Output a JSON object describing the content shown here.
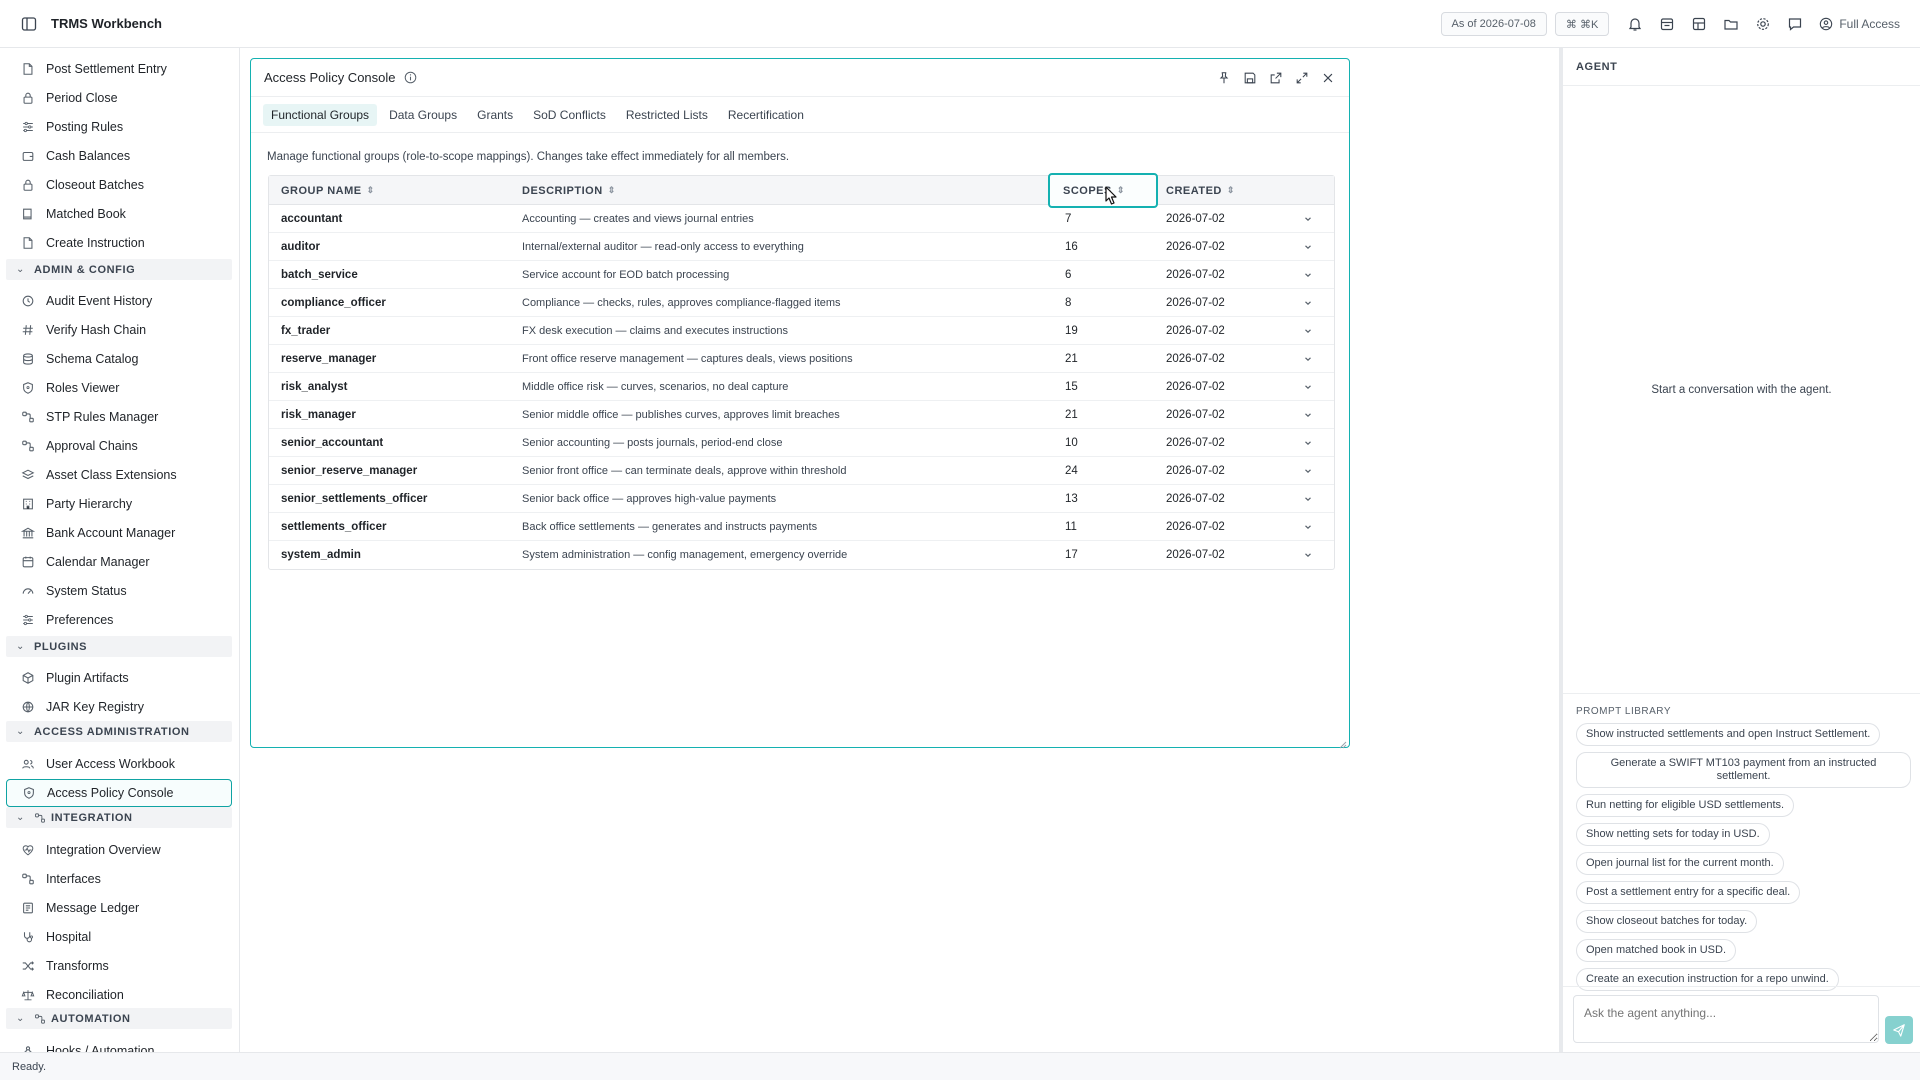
{
  "app": {
    "title": "TRMS Workbench"
  },
  "topbar": {
    "as_of": "As of 2026-07-08",
    "shortcut": "⌘ ⌘K",
    "access": "Full Access",
    "icons": [
      "bell-icon",
      "calendar-icon",
      "layout-icon",
      "folder-icon",
      "gear-icon",
      "chat-icon"
    ]
  },
  "sidebar": {
    "items_top": [
      {
        "label": "Post Settlement Entry",
        "icon": "doc-edit-icon"
      },
      {
        "label": "Period Close",
        "icon": "lock-icon"
      },
      {
        "label": "Posting Rules",
        "icon": "sliders-icon"
      },
      {
        "label": "Cash Balances",
        "icon": "wallet-icon"
      },
      {
        "label": "Closeout Batches",
        "icon": "lock-icon"
      },
      {
        "label": "Matched Book",
        "icon": "book-icon"
      },
      {
        "label": "Create Instruction",
        "icon": "doc-edit-icon"
      }
    ],
    "section_admin": "ADMIN & CONFIG",
    "items_admin": [
      {
        "label": "Audit Event History",
        "icon": "history-icon"
      },
      {
        "label": "Verify Hash Chain",
        "icon": "hash-icon"
      },
      {
        "label": "Schema Catalog",
        "icon": "database-icon"
      },
      {
        "label": "Roles Viewer",
        "icon": "shield-icon"
      },
      {
        "label": "STP Rules Manager",
        "icon": "workflow-icon"
      },
      {
        "label": "Approval Chains",
        "icon": "workflow-icon"
      },
      {
        "label": "Asset Class Extensions",
        "icon": "layers-icon"
      },
      {
        "label": "Party Hierarchy",
        "icon": "building-icon"
      },
      {
        "label": "Bank Account Manager",
        "icon": "bank-icon"
      },
      {
        "label": "Calendar Manager",
        "icon": "calendar-icon"
      },
      {
        "label": "System Status",
        "icon": "gauge-icon"
      },
      {
        "label": "Preferences",
        "icon": "sliders-icon"
      }
    ],
    "section_plugins": "PLUGINS",
    "items_plugins": [
      {
        "label": "Plugin Artifacts",
        "icon": "package-icon"
      },
      {
        "label": "JAR Key Registry",
        "icon": "globe-icon"
      }
    ],
    "section_access": "ACCESS ADMINISTRATION",
    "items_access": [
      {
        "label": "User Access Workbook",
        "icon": "users-icon"
      },
      {
        "label": "Access Policy Console",
        "icon": "shield-icon"
      }
    ],
    "section_integration": "INTEGRATION",
    "items_integration": [
      {
        "label": "Integration Overview",
        "icon": "heart-icon"
      },
      {
        "label": "Interfaces",
        "icon": "workflow-icon"
      },
      {
        "label": "Message Ledger",
        "icon": "ledger-icon"
      },
      {
        "label": "Hospital",
        "icon": "stethoscope-icon"
      },
      {
        "label": "Transforms",
        "icon": "shuffle-icon"
      },
      {
        "label": "Reconciliation",
        "icon": "scale-icon"
      }
    ],
    "section_automation": "AUTOMATION",
    "items_automation": [
      {
        "label": "Hooks / Automation",
        "icon": "webhook-icon"
      }
    ]
  },
  "console": {
    "title": "Access Policy Console",
    "tabs": [
      "Functional Groups",
      "Data Groups",
      "Grants",
      "SoD Conflicts",
      "Restricted Lists",
      "Recertification"
    ],
    "description": "Manage functional groups (role-to-scope mappings). Changes take effect immediately for all members.",
    "columns": {
      "name": "GROUP NAME",
      "description": "DESCRIPTION",
      "scopes": "SCOPES",
      "created": "CREATED"
    },
    "rows": [
      {
        "name": "accountant",
        "description": "Accounting — creates and views journal entries",
        "scopes": "7",
        "created": "2026-07-02"
      },
      {
        "name": "auditor",
        "description": "Internal/external auditor — read-only access to everything",
        "scopes": "16",
        "created": "2026-07-02"
      },
      {
        "name": "batch_service",
        "description": "Service account for EOD batch processing",
        "scopes": "6",
        "created": "2026-07-02"
      },
      {
        "name": "compliance_officer",
        "description": "Compliance — checks, rules, approves compliance-flagged items",
        "scopes": "8",
        "created": "2026-07-02"
      },
      {
        "name": "fx_trader",
        "description": "FX desk execution — claims and executes instructions",
        "scopes": "19",
        "created": "2026-07-02"
      },
      {
        "name": "reserve_manager",
        "description": "Front office reserve management — captures deals, views positions",
        "scopes": "21",
        "created": "2026-07-02"
      },
      {
        "name": "risk_analyst",
        "description": "Middle office risk — curves, scenarios, no deal capture",
        "scopes": "15",
        "created": "2026-07-02"
      },
      {
        "name": "risk_manager",
        "description": "Senior middle office — publishes curves, approves limit breaches",
        "scopes": "21",
        "created": "2026-07-02"
      },
      {
        "name": "senior_accountant",
        "description": "Senior accounting — posts journals, period-end close",
        "scopes": "10",
        "created": "2026-07-02"
      },
      {
        "name": "senior_reserve_manager",
        "description": "Senior front office — can terminate deals, approve within threshold",
        "scopes": "24",
        "created": "2026-07-02"
      },
      {
        "name": "senior_settlements_officer",
        "description": "Senior back office — approves high-value payments",
        "scopes": "13",
        "created": "2026-07-02"
      },
      {
        "name": "settlements_officer",
        "description": "Back office settlements — generates and instructs payments",
        "scopes": "11",
        "created": "2026-07-02"
      },
      {
        "name": "system_admin",
        "description": "System administration — config management, emergency override",
        "scopes": "17",
        "created": "2026-07-02"
      }
    ]
  },
  "agent": {
    "header": "AGENT",
    "empty": "Start a conversation with the agent.",
    "prompt_library_title": "PROMPT LIBRARY",
    "prompts": [
      "Show instructed settlements and open Instruct Settlement.",
      "Generate a SWIFT MT103 payment from an instructed settlement.",
      "Run netting for eligible USD settlements.",
      "Show netting sets for today in USD.",
      "Open journal list for the current month.",
      "Post a settlement entry for a specific deal.",
      "Show closeout batches for today.",
      "Open matched book in USD.",
      "Create an execution instruction for a repo unwind."
    ],
    "input_placeholder": "Ask the agent anything..."
  },
  "status": {
    "text": "Ready."
  },
  "colors": {
    "accent": "#14b1b1",
    "send": "#86d1cf"
  }
}
